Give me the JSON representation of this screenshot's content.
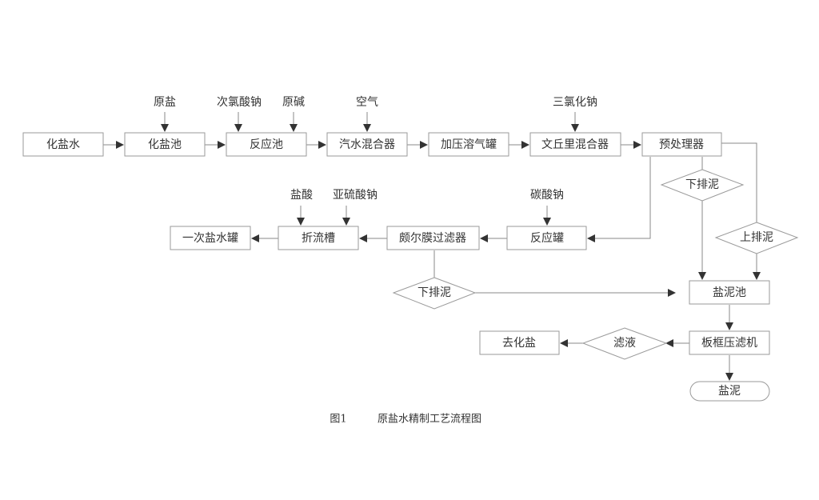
{
  "diagram": {
    "caption": {
      "figure_no": "图1",
      "title": "原盐水精制工艺流程图"
    },
    "nodes": {
      "huayanshui": "化盐水",
      "huayanchi": "化盐池",
      "fanyingchi": "反应池",
      "qishui_hunheqi": "汽水混合器",
      "jiaya_rongqiguan": "加压溶气罐",
      "wenqiuli_hunheqi": "文丘里混合器",
      "yuchuliqi": "预处理器",
      "yici_yanshuiguan": "一次盐水罐",
      "zheliucao": "折流槽",
      "poer_mo_guolvqi": "颇尔膜过滤器",
      "fanyingguan": "反应罐",
      "yannichi": "盐泥池",
      "bankuang_yalvji": "板框压滤机",
      "qu_huayan": "去化盐",
      "yanni": "盐泥"
    },
    "decisions": {
      "xiapaini_1": "下排泥",
      "shangpaini": "上排泥",
      "xiapaini_2": "下排泥",
      "lvye": "滤液"
    },
    "inputs": {
      "yuanyan": "原盐",
      "cilvsuanna": "次氯酸钠",
      "yuanjian": "原碱",
      "kongqi": "空气",
      "sanlvhuana": "三氯化钠",
      "yansuan": "盐酸",
      "yaliusuanna": "亚硫酸钠",
      "tansuanna": "碳酸钠"
    },
    "colors": {
      "line": "#8a8a8a",
      "box_border": "#9a9a9a",
      "text": "#333333",
      "arrow": "#333333"
    }
  }
}
